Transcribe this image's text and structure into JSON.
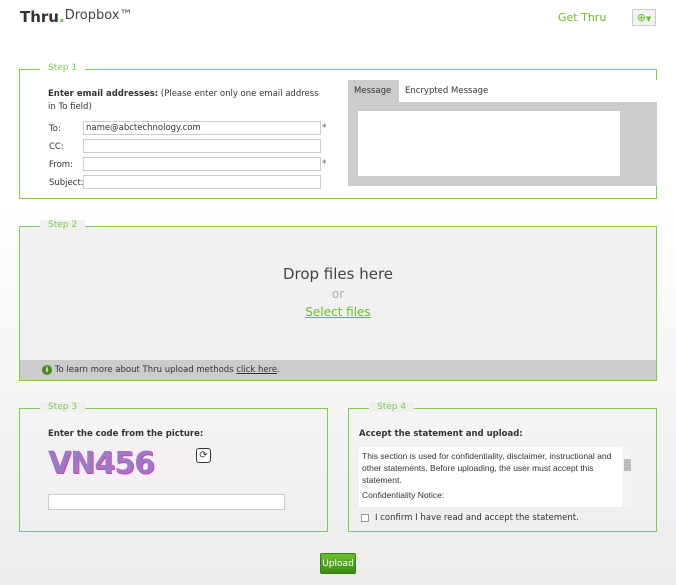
{
  "header": {
    "logo_brand": "Thru",
    "logo_dot": ".",
    "logo_product": "Dropbox™",
    "get_thru": "Get Thru",
    "language_icon": "globe-icon"
  },
  "step1": {
    "legend": "Step 1",
    "intro_bold": "Enter email addresses:",
    "intro_note": "(Please enter only one email address in To field)",
    "to_label": "To:",
    "to_value": "name@abctechnology.com",
    "cc_label": "CC:",
    "from_label": "From:",
    "subject_label": "Subject:",
    "required_mark": "*",
    "tab_message": "Message",
    "tab_encrypted": "Encrypted Message"
  },
  "step2": {
    "legend": "Step 2",
    "drop": "Drop files here",
    "or": "or",
    "select": "Select files",
    "info_pre": "To learn more about Thru upload methods ",
    "info_link": "click here",
    "info_post": "."
  },
  "step3": {
    "legend": "Step 3",
    "label": "Enter the code from the picture:",
    "captcha": "VN456"
  },
  "step4": {
    "legend": "Step 4",
    "label": "Accept the statement and upload:",
    "statement": "This section is used for confidentiality, disclaimer, instructional and other statements. Before uploading, the user must accept this statement.",
    "statement2": "Confidentiality Notice:",
    "confirm": "I confirm I have read and accept the statement."
  },
  "upload": "Upload",
  "colors": {
    "accent": "#6cbd2a",
    "border": "#7ccd4a"
  }
}
